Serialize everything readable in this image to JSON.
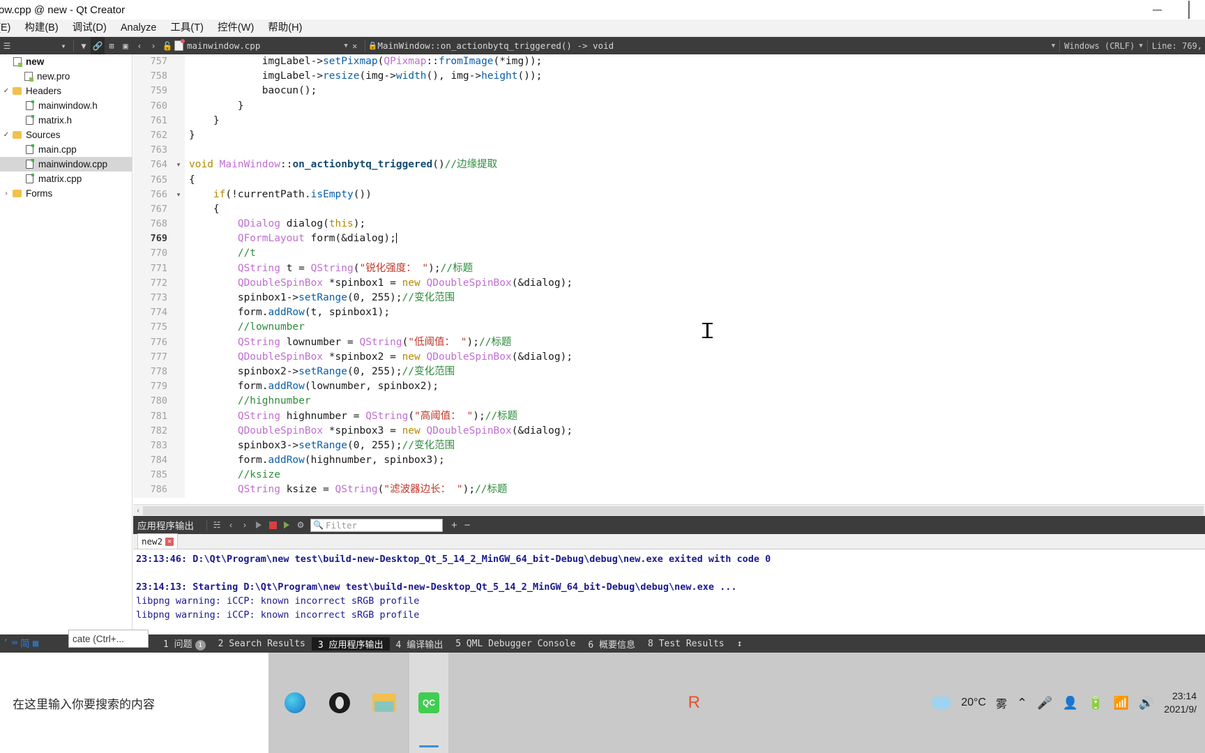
{
  "window": {
    "title": "ow.cpp @ new - Qt Creator",
    "minimize": "minimize-icon",
    "restore": "restore-icon"
  },
  "menubar": {
    "items": [
      {
        "label": " (E)"
      },
      {
        "label": "构建(B)"
      },
      {
        "label": "调试(D)"
      },
      {
        "label": "Analyze"
      },
      {
        "label": "工具(T)"
      },
      {
        "label": "控件(W)"
      },
      {
        "label": "帮助(H)"
      }
    ]
  },
  "toolbar": {
    "filename": "mainwindow.cpp",
    "symbol": "MainWindow::on_actionbytq_triggered() -> void",
    "line_ending": "Windows (CRLF)",
    "line_info": "Line: 769,",
    "icons": [
      "hamburger-icon",
      "chevron-down-icon",
      "filter-icon",
      "link-icon",
      "split-icon",
      "close-split-icon",
      "back-icon",
      "forward-icon",
      "lock-open-icon"
    ]
  },
  "sidebar": {
    "items": [
      {
        "label": "new",
        "icon": "project-icon",
        "indent": 0,
        "bold": true,
        "expander": ""
      },
      {
        "label": "new.pro",
        "icon": "pro-file-icon",
        "indent": 1,
        "bold": false,
        "expander": ""
      },
      {
        "label": "Headers",
        "icon": "folder-icon",
        "indent": 1,
        "bold": false,
        "expander": "⌄"
      },
      {
        "label": "mainwindow.h",
        "icon": "header-file-icon",
        "indent": 2,
        "bold": false,
        "expander": ""
      },
      {
        "label": "matrix.h",
        "icon": "header-file-icon",
        "indent": 2,
        "bold": false,
        "expander": ""
      },
      {
        "label": "Sources",
        "icon": "folder-icon",
        "indent": 1,
        "bold": false,
        "expander": "⌄"
      },
      {
        "label": "main.cpp",
        "icon": "cpp-file-icon",
        "indent": 2,
        "bold": false,
        "expander": ""
      },
      {
        "label": "mainwindow.cpp",
        "icon": "cpp-file-icon",
        "indent": 2,
        "bold": false,
        "expander": "",
        "selected": true
      },
      {
        "label": "matrix.cpp",
        "icon": "cpp-file-icon",
        "indent": 2,
        "bold": false,
        "expander": ""
      },
      {
        "label": "Forms",
        "icon": "forms-folder-icon",
        "indent": 1,
        "bold": false,
        "expander": "›"
      }
    ]
  },
  "editor": {
    "current_line": 769,
    "lines": [
      {
        "n": 757,
        "fold": "",
        "text": "            imgLabel->setPixmap(QPixmap::fromImage(*img));"
      },
      {
        "n": 758,
        "fold": "",
        "text": "            imgLabel->resize(img->width(), img->height());"
      },
      {
        "n": 759,
        "fold": "",
        "text": "            baocun();"
      },
      {
        "n": 760,
        "fold": "",
        "text": "        }"
      },
      {
        "n": 761,
        "fold": "",
        "text": "    }"
      },
      {
        "n": 762,
        "fold": "",
        "text": "}"
      },
      {
        "n": 763,
        "fold": "",
        "text": ""
      },
      {
        "n": 764,
        "fold": "▾",
        "text": "void MainWindow::on_actionbytq_triggered()//边缘提取"
      },
      {
        "n": 765,
        "fold": "",
        "text": "{"
      },
      {
        "n": 766,
        "fold": "▾",
        "text": "    if(!currentPath.isEmpty())"
      },
      {
        "n": 767,
        "fold": "",
        "text": "    {"
      },
      {
        "n": 768,
        "fold": "",
        "text": "        QDialog dialog(this);"
      },
      {
        "n": 769,
        "fold": "",
        "text": "        QFormLayout form(&dialog);"
      },
      {
        "n": 770,
        "fold": "",
        "text": "        //t"
      },
      {
        "n": 771,
        "fold": "",
        "text": "        QString t = QString(\"锐化强度： \");//标题"
      },
      {
        "n": 772,
        "fold": "",
        "text": "        QDoubleSpinBox *spinbox1 = new QDoubleSpinBox(&dialog);"
      },
      {
        "n": 773,
        "fold": "",
        "text": "        spinbox1->setRange(0, 255);//变化范围"
      },
      {
        "n": 774,
        "fold": "",
        "text": "        form.addRow(t, spinbox1);"
      },
      {
        "n": 775,
        "fold": "",
        "text": "        //lownumber"
      },
      {
        "n": 776,
        "fold": "",
        "text": "        QString lownumber = QString(\"低阈值： \");//标题"
      },
      {
        "n": 777,
        "fold": "",
        "text": "        QDoubleSpinBox *spinbox2 = new QDoubleSpinBox(&dialog);"
      },
      {
        "n": 778,
        "fold": "",
        "text": "        spinbox2->setRange(0, 255);//变化范围"
      },
      {
        "n": 779,
        "fold": "",
        "text": "        form.addRow(lownumber, spinbox2);"
      },
      {
        "n": 780,
        "fold": "",
        "text": "        //highnumber"
      },
      {
        "n": 781,
        "fold": "",
        "text": "        QString highnumber = QString(\"高阈值： \");//标题"
      },
      {
        "n": 782,
        "fold": "",
        "text": "        QDoubleSpinBox *spinbox3 = new QDoubleSpinBox(&dialog);"
      },
      {
        "n": 783,
        "fold": "",
        "text": "        spinbox3->setRange(0, 255);//变化范围"
      },
      {
        "n": 784,
        "fold": "",
        "text": "        form.addRow(highnumber, spinbox3);"
      },
      {
        "n": 785,
        "fold": "",
        "text": "        //ksize"
      },
      {
        "n": 786,
        "fold": "",
        "text": "        QString ksize = QString(\"滤波器边长： \");//标题"
      }
    ]
  },
  "output_pane": {
    "title": "应用程序输出",
    "filter_placeholder": "Filter",
    "tab_label": "new2",
    "lines": [
      {
        "text": "23:13:46: D:\\Qt\\Program\\new test\\build-new-Desktop_Qt_5_14_2_MinGW_64_bit-Debug\\debug\\new.exe exited with code 0",
        "bold": true
      },
      {
        "text": "",
        "bold": false
      },
      {
        "text": "23:14:13: Starting D:\\Qt\\Program\\new test\\build-new-Desktop_Qt_5_14_2_MinGW_64_bit-Debug\\debug\\new.exe ...",
        "bold": true
      },
      {
        "text": "libpng warning: iCCP: known incorrect sRGB profile",
        "bold": false
      },
      {
        "text": "libpng warning: iCCP: known incorrect sRGB profile",
        "bold": false
      }
    ]
  },
  "status_bar": {
    "locator_placeholder": "cate (Ctrl+...",
    "items": [
      {
        "label": "1 问题",
        "badge": "1",
        "active": false
      },
      {
        "label": "2 Search Results",
        "badge": "",
        "active": false
      },
      {
        "label": "3 应用程序输出",
        "badge": "",
        "active": true
      },
      {
        "label": "4 编译输出",
        "badge": "",
        "active": false
      },
      {
        "label": "5 QML Debugger Console",
        "badge": "",
        "active": false
      },
      {
        "label": "6 概要信息",
        "badge": "",
        "active": false
      },
      {
        "label": "8 Test Results",
        "badge": "",
        "active": false
      }
    ],
    "resize_handle": "↕"
  },
  "taskbar": {
    "search_placeholder": "在这里输入你要搜索的内容",
    "apps": [
      {
        "name": "edge-icon",
        "active": false
      },
      {
        "name": "obs-icon",
        "active": false
      },
      {
        "name": "file-explorer-icon",
        "active": false
      },
      {
        "name": "qt-creator-icon",
        "active": true
      }
    ],
    "tray": {
      "sogou": "sogou-icon",
      "weather_temp": "20°C",
      "weather_desc": "雾",
      "chevron": "chevron-up-icon",
      "mic": "microphone-icon",
      "qq": "qq-icon",
      "battery": "battery-icon",
      "wifi": "wifi-icon",
      "speaker": "speaker-icon",
      "time": "23:14",
      "date": "2021/9/"
    }
  },
  "colors": {
    "toolbar_dark": "#3c3c3c",
    "editor_bg": "#ffffff",
    "selection": "#d6d6d6",
    "output_text": "#1a1a8c",
    "accent_green": "#41cd52"
  }
}
